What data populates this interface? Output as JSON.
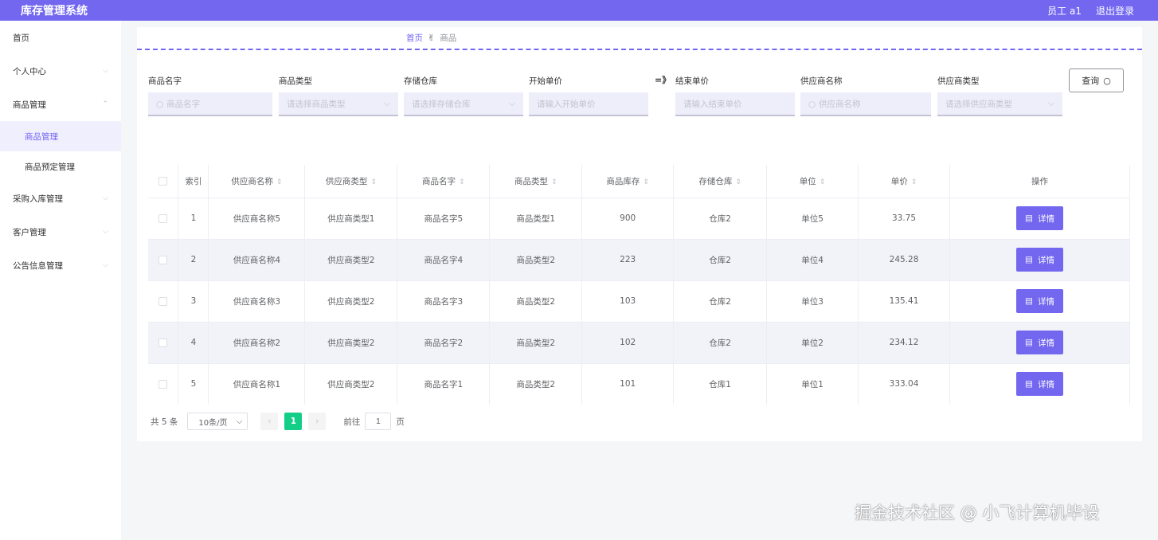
{
  "app": {
    "title": "库存管理系统"
  },
  "header": {
    "user": "员工 a1",
    "logout": "退出登录"
  },
  "sidebar": {
    "items": [
      {
        "label": "首页"
      },
      {
        "label": "个人中心"
      },
      {
        "label": "商品管理"
      },
      {
        "label": "商品管理"
      },
      {
        "label": "商品预定管理"
      },
      {
        "label": "采购入库管理"
      },
      {
        "label": "客户管理"
      },
      {
        "label": "公告信息管理"
      }
    ]
  },
  "breadcrumb": {
    "home": "首页",
    "current": "商品"
  },
  "filters": {
    "product_name": {
      "label": "商品名字",
      "placeholder": "商品名字"
    },
    "product_type": {
      "label": "商品类型",
      "placeholder": "请选择商品类型"
    },
    "warehouse": {
      "label": "存储仓库",
      "placeholder": "请选择存储仓库"
    },
    "start_price": {
      "label": "开始单价",
      "placeholder": "请输入开始单价"
    },
    "arrow": "=》",
    "end_price": {
      "label": "结束单价",
      "placeholder": "请输入结束单价"
    },
    "supplier_name": {
      "label": "供应商名称",
      "placeholder": "供应商名称"
    },
    "supplier_type": {
      "label": "供应商类型",
      "placeholder": "请选择供应商类型"
    },
    "query_label": "查询"
  },
  "table": {
    "headers": [
      "索引",
      "供应商名称",
      "供应商类型",
      "商品名字",
      "商品类型",
      "商品库存",
      "存储仓库",
      "单位",
      "单价",
      "操作"
    ],
    "rows": [
      [
        "1",
        "供应商名称5",
        "供应商类型1",
        "商品名字5",
        "商品类型1",
        "900",
        "仓库2",
        "单位5",
        "33.75"
      ],
      [
        "2",
        "供应商名称4",
        "供应商类型2",
        "商品名字4",
        "商品类型2",
        "223",
        "仓库2",
        "单位4",
        "245.28"
      ],
      [
        "3",
        "供应商名称3",
        "供应商类型2",
        "商品名字3",
        "商品类型2",
        "103",
        "仓库2",
        "单位3",
        "135.41"
      ],
      [
        "4",
        "供应商名称2",
        "供应商类型2",
        "商品名字2",
        "商品类型2",
        "102",
        "仓库2",
        "单位2",
        "234.12"
      ],
      [
        "5",
        "供应商名称1",
        "供应商类型2",
        "商品名字1",
        "商品类型2",
        "101",
        "仓库1",
        "单位1",
        "333.04"
      ]
    ],
    "detail_label": "详情"
  },
  "pagination": {
    "total": "共 5 条",
    "page_size": "10条/页",
    "current": "1",
    "goto": "前往",
    "goto_value": "1",
    "page_unit": "页"
  },
  "watermark": "掘金技术社区 @ 小飞计算机毕设",
  "colors": {
    "accent": "#7367f0",
    "pager_active": "#13ce86"
  }
}
